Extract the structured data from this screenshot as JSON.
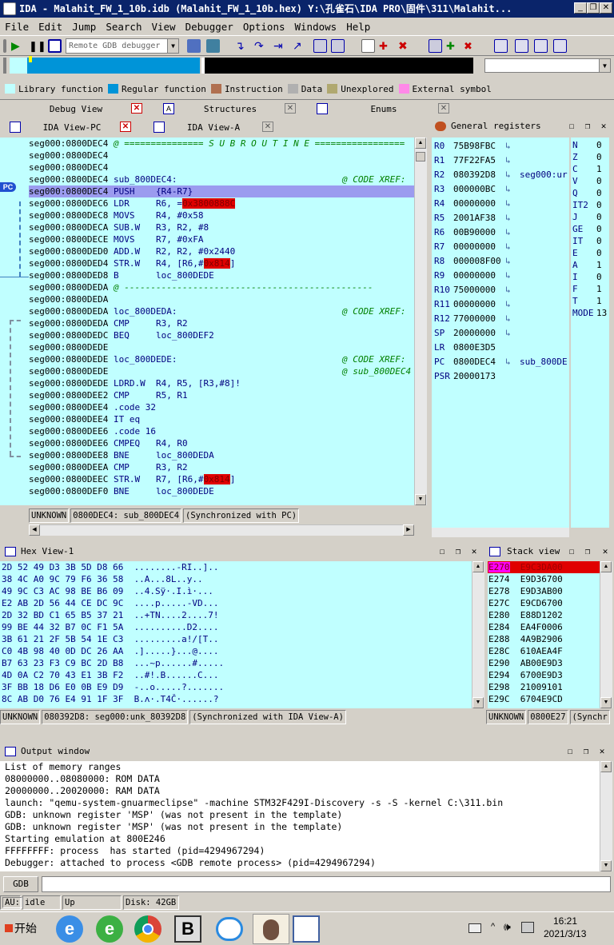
{
  "window": {
    "title": "IDA - Malahit_FW_1_10b.idb (Malahit_FW_1_10b.hex) Y:\\孔雀石\\IDA PRO\\固件\\311\\Malahit..."
  },
  "menu": [
    "File",
    "Edit",
    "Jump",
    "Search",
    "View",
    "Debugger",
    "Options",
    "Windows",
    "Help"
  ],
  "toolbar": {
    "debugger_combo": "Remote GDB debugger"
  },
  "legend": [
    {
      "label": "Library function",
      "color": "#c0ffff"
    },
    {
      "label": "Regular function",
      "color": "#0094d8"
    },
    {
      "label": "Instruction",
      "color": "#b07050"
    },
    {
      "label": "Data",
      "color": "#b0b0b0"
    },
    {
      "label": "Unexplored",
      "color": "#b0a870"
    },
    {
      "label": "External symbol",
      "color": "#ff88e8"
    }
  ],
  "top_tabs": [
    "Debug View",
    "Structures",
    "Enums"
  ],
  "view_tabs": [
    "IDA View-PC",
    "IDA View-A"
  ],
  "asm": {
    "pc_marker": "PC",
    "lines": [
      {
        "a": "seg000:0800DEC4",
        "t": " @ =============== S U B R O U T I N E =================",
        "c": "",
        "k": "sep"
      },
      {
        "a": "seg000:0800DEC4",
        "t": "",
        "c": ""
      },
      {
        "a": "seg000:0800DEC4",
        "t": "",
        "c": ""
      },
      {
        "a": "seg000:0800DEC4",
        "t": " sub_800DEC4:",
        "c": "@ CODE XREF:"
      },
      {
        "a": "seg000:0800DEC4",
        "t": " PUSH    {R4-R7}",
        "c": "",
        "hl": true
      },
      {
        "a": "seg000:0800DEC6",
        "t": " LDR     R6, =",
        "r": "0x3800888C",
        "c": ""
      },
      {
        "a": "seg000:0800DEC8",
        "t": " MOVS    R4, #0x58",
        "c": ""
      },
      {
        "a": "seg000:0800DECA",
        "t": " SUB.W   R3, R2, #8",
        "c": ""
      },
      {
        "a": "seg000:0800DECE",
        "t": " MOVS    R7, #0xFA",
        "c": ""
      },
      {
        "a": "seg000:0800DED0",
        "t": " ADD.W   R2, R2, #0x2440",
        "c": ""
      },
      {
        "a": "seg000:0800DED4",
        "t": " STR.W   R4, [R6,#",
        "r": "0x814",
        "e": "]",
        "c": ""
      },
      {
        "a": "seg000:0800DED8",
        "t": " B       loc_800DEDE",
        "c": ""
      },
      {
        "a": "seg000:0800DEDA",
        "t": " @ -----------------------------------------------",
        "c": "",
        "k": "sep"
      },
      {
        "a": "seg000:0800DEDA",
        "t": "",
        "c": ""
      },
      {
        "a": "seg000:0800DEDA",
        "t": " loc_800DEDA:",
        "c": "@ CODE XREF:"
      },
      {
        "a": "seg000:0800DEDA",
        "t": " CMP     R3, R2",
        "c": ""
      },
      {
        "a": "seg000:0800DEDC",
        "t": " BEQ     loc_800DEF2",
        "c": ""
      },
      {
        "a": "seg000:0800DEDE",
        "t": "",
        "c": ""
      },
      {
        "a": "seg000:0800DEDE",
        "t": " loc_800DEDE:",
        "c": "@ CODE XREF:"
      },
      {
        "a": "seg000:0800DEDE",
        "t": "",
        "c": "@ sub_800DEC4"
      },
      {
        "a": "seg000:0800DEDE",
        "t": " LDRD.W  R4, R5, [R3,#8]!",
        "c": ""
      },
      {
        "a": "seg000:0800DEE2",
        "t": " CMP     R5, R1",
        "c": ""
      },
      {
        "a": "seg000:0800DEE4",
        "t": " .code 32",
        "c": ""
      },
      {
        "a": "seg000:0800DEE4",
        "t": " IT eq",
        "c": ""
      },
      {
        "a": "seg000:0800DEE6",
        "t": " .code 16",
        "c": ""
      },
      {
        "a": "seg000:0800DEE6",
        "t": " CMPEQ   R4, R0",
        "c": ""
      },
      {
        "a": "seg000:0800DEE8",
        "t": " BNE     loc_800DEDA",
        "c": ""
      },
      {
        "a": "seg000:0800DEEA",
        "t": " CMP     R3, R2",
        "c": ""
      },
      {
        "a": "seg000:0800DEEC",
        "t": " STR.W   R7, [R6,#",
        "r": "0x814",
        "e": "]",
        "c": ""
      },
      {
        "a": "seg000:0800DEF0",
        "t": " BNE     loc_800DEDE",
        "c": ""
      }
    ],
    "status": [
      "UNKNOWN",
      "0800DEC4: sub_800DEC4",
      "(Synchronized with PC)"
    ]
  },
  "registers": {
    "title": "General registers",
    "rows": [
      {
        "n": "R0",
        "v": "75B98FBC",
        "arrow": true,
        "extra": ""
      },
      {
        "n": "R1",
        "v": "77F22FA5",
        "arrow": true,
        "extra": ""
      },
      {
        "n": "R2",
        "v": "080392D8",
        "arrow": true,
        "extra": "seg000:ur"
      },
      {
        "n": "R3",
        "v": "000000BC",
        "arrow": true,
        "extra": ""
      },
      {
        "n": "R4",
        "v": "00000000",
        "arrow": true,
        "extra": ""
      },
      {
        "n": "R5",
        "v": "2001AF38",
        "arrow": true,
        "extra": ""
      },
      {
        "n": "R6",
        "v": "00B90000",
        "arrow": true,
        "extra": ""
      },
      {
        "n": "R7",
        "v": "00000000",
        "arrow": true,
        "extra": ""
      },
      {
        "n": "R8",
        "v": "000008F00",
        "arrow": true,
        "extra": ""
      },
      {
        "n": "R9",
        "v": "00000000",
        "arrow": true,
        "extra": ""
      },
      {
        "n": "R10",
        "v": "75000000",
        "arrow": true,
        "extra": ""
      },
      {
        "n": "R11",
        "v": "00000000",
        "arrow": true,
        "extra": ""
      },
      {
        "n": "R12",
        "v": "77000000",
        "arrow": true,
        "extra": ""
      },
      {
        "n": "SP",
        "v": "20000000",
        "arrow": true,
        "extra": ""
      },
      {
        "n": "LR",
        "v": "0800E3D5",
        "arrow": false,
        "extra": ""
      },
      {
        "n": "PC",
        "v": "0800DEC4",
        "arrow": true,
        "extra": "sub_800DE"
      },
      {
        "n": "PSR",
        "v": "20000173",
        "arrow": false,
        "extra": ""
      }
    ],
    "flags": [
      {
        "n": "N",
        "v": "0"
      },
      {
        "n": "Z",
        "v": "0"
      },
      {
        "n": "C",
        "v": "1"
      },
      {
        "n": "V",
        "v": "0"
      },
      {
        "n": "Q",
        "v": "0"
      },
      {
        "n": "IT2",
        "v": "0"
      },
      {
        "n": "J",
        "v": "0"
      },
      {
        "n": "GE",
        "v": "0"
      },
      {
        "n": "IT",
        "v": "0"
      },
      {
        "n": "E",
        "v": "0"
      },
      {
        "n": "A",
        "v": "1"
      },
      {
        "n": "I",
        "v": "0"
      },
      {
        "n": "F",
        "v": "1"
      },
      {
        "n": "T",
        "v": "1"
      },
      {
        "n": "MODE",
        "v": "13"
      }
    ]
  },
  "hex": {
    "title": "Hex View-1",
    "rows": [
      "2D 52 49 D3 3B 5D D8 66  ........-RI..]..",
      "38 4C A0 9C 79 F6 36 58  ..A...8L..y..",
      "49 9C C3 AC 98 BE B6 09  ..4.Sÿ·.I.ì·...",
      "E2 AB 2D 56 44 CE DC 9C  ....p.....-VD...",
      "2D 32 BD C1 65 B5 37 21  ..+TN....2....7!",
      "99 BE 44 32 B7 0C F1 5A  ..........D2....",
      "3B 61 21 2F 5B 54 1E C3  .........a!/[T..",
      "C0 4B 98 40 0D DC 26 AA  .].....}...@....",
      "B7 63 23 F3 C9 BC 2D B8  ...~p......#.....",
      "4D 0A C2 70 43 E1 3B F2  ..#!.B......C...",
      "3F BB 18 D6 E0 0B E9 D9  -..o.....?.......",
      "8C AB D0 76 E4 91 1F 3F  B.ʌ·.T4Č·......?"
    ],
    "status": [
      "UNKNOWN",
      "080392D8: seg000:unk_80392D8",
      "(Synchronized with IDA View-A)"
    ]
  },
  "stack": {
    "title": "Stack view",
    "rows": [
      {
        "a": "E270",
        "v": "E9C3DA00",
        "hl": true
      },
      {
        "a": "E274",
        "v": "E9D36700"
      },
      {
        "a": "E278",
        "v": "E9D3AB00"
      },
      {
        "a": "E27C",
        "v": "E9CD6700"
      },
      {
        "a": "E280",
        "v": "E88D1202"
      },
      {
        "a": "E284",
        "v": "EA4F0006"
      },
      {
        "a": "E288",
        "v": "4A9B2906"
      },
      {
        "a": "E28C",
        "v": "610AEA4F"
      },
      {
        "a": "E290",
        "v": "AB00E9D3"
      },
      {
        "a": "E294",
        "v": "6700E9D3"
      },
      {
        "a": "E298",
        "v": "21009101"
      },
      {
        "a": "E29C",
        "v": "6704E9CD"
      }
    ],
    "status": [
      "UNKNOWN",
      "0800E27",
      "(Synchr"
    ]
  },
  "output": {
    "title": "Output window",
    "lines": [
      "List of memory ranges",
      "08000000..08080000: ROM DATA",
      "20000000..20020000: RAM DATA",
      "launch: \"qemu-system-gnuarmeclipse\" -machine STM32F429I-Discovery -s -S -kernel C:\\311.bin",
      "GDB: unknown register 'MSP' (was not present in the template)",
      "GDB: unknown register 'MSP' (was not present in the template)",
      "Starting emulation at 800E246",
      "FFFFFFFF: process  has started (pid=4294967294)",
      "Debugger: attached to process <GDB remote process> (pid=4294967294)"
    ],
    "cmd_label": "GDB"
  },
  "statusbar": {
    "au": "AU:",
    "state": "idle",
    "dir": "Up",
    "disk": "Disk: 42GB"
  },
  "taskbar": {
    "start": "开始",
    "time": "16:21",
    "date": "2021/3/13"
  }
}
